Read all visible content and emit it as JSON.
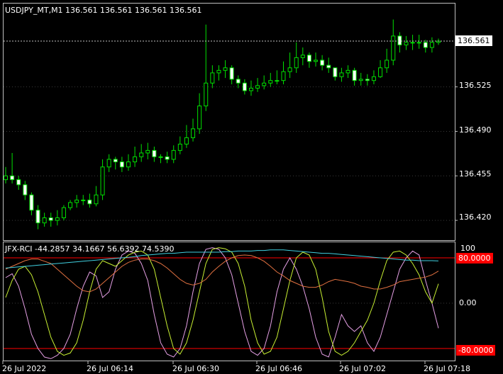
{
  "main_chart": {
    "header": "USDJPY_MT,M1  136.561 136.561 136.561 136.561",
    "price_ticks": [
      "136.525",
      "136.490",
      "136.455",
      "136.420"
    ],
    "current_price_tag": "136.561",
    "current_price": 136.561,
    "price_range": [
      136.405,
      136.59
    ],
    "colors": {
      "bull": "#00e000",
      "bear": "#ffffff",
      "bid_line": "#c0c0c0"
    }
  },
  "indicator": {
    "header": "JFX-RCI -44.2857 34.1667 56.6392 74.5390",
    "level_tags": [
      "80.0000",
      "-80.0000"
    ],
    "axis_labels": [
      "100",
      "0.00"
    ],
    "range": [
      -100,
      100
    ],
    "level_color": "#ff0000",
    "series_colors": [
      "#e6a0e6",
      "#c8f032",
      "#e07040",
      "#40d0e0"
    ]
  },
  "time_axis": [
    "26 Jul 2022",
    "26 Jul 06:14",
    "26 Jul 06:30",
    "26 Jul 06:46",
    "26 Jul 07:02",
    "26 Jul 07:18"
  ],
  "chart_data": {
    "type": "line",
    "candles": {
      "open": [
        136.452,
        136.455,
        136.452,
        136.448,
        136.44,
        136.428,
        136.418,
        136.422,
        136.42,
        136.422,
        136.43,
        136.434,
        136.436,
        136.436,
        136.433,
        136.44,
        136.462,
        136.468,
        136.466,
        136.462,
        136.466,
        136.47,
        136.473,
        136.475,
        136.47,
        136.47,
        136.468,
        136.475,
        136.48,
        136.485,
        136.492,
        136.51,
        136.528,
        136.536,
        136.538,
        136.54,
        136.531,
        136.528,
        136.522,
        136.524,
        136.526,
        136.528,
        136.53,
        136.53,
        136.537,
        136.54,
        136.548,
        136.55,
        136.545,
        136.546,
        136.542,
        136.54,
        136.533,
        136.536,
        136.538,
        136.53,
        136.531,
        136.53,
        136.533,
        136.54,
        136.546,
        136.565,
        136.558,
        136.56,
        136.56,
        136.56,
        136.556,
        136.56
      ],
      "close": [
        136.455,
        136.452,
        136.448,
        136.44,
        136.428,
        136.418,
        136.422,
        136.42,
        136.422,
        136.43,
        136.434,
        136.436,
        136.436,
        136.433,
        136.44,
        136.462,
        136.468,
        136.466,
        136.462,
        136.466,
        136.47,
        136.473,
        136.475,
        136.47,
        136.47,
        136.468,
        136.475,
        136.48,
        136.485,
        136.492,
        136.51,
        136.528,
        136.536,
        136.538,
        136.54,
        136.531,
        136.528,
        136.522,
        136.524,
        136.526,
        136.528,
        136.53,
        136.53,
        136.537,
        136.54,
        136.548,
        136.55,
        136.545,
        136.546,
        136.542,
        136.54,
        136.533,
        136.536,
        136.538,
        136.53,
        136.531,
        136.53,
        136.533,
        136.54,
        136.546,
        136.565,
        136.558,
        136.56,
        136.56,
        136.56,
        136.556,
        136.56,
        136.561
      ],
      "high": [
        136.462,
        136.473,
        136.455,
        136.451,
        136.442,
        136.432,
        136.426,
        136.426,
        136.428,
        136.432,
        136.436,
        136.44,
        136.44,
        136.441,
        136.447,
        136.468,
        136.472,
        136.47,
        136.47,
        136.472,
        136.478,
        136.48,
        136.481,
        136.478,
        136.472,
        136.474,
        136.479,
        136.486,
        136.495,
        136.5,
        136.52,
        136.574,
        136.542,
        136.542,
        136.546,
        136.542,
        136.534,
        136.531,
        136.53,
        136.532,
        136.534,
        136.536,
        136.538,
        136.545,
        136.552,
        136.56,
        136.556,
        136.552,
        136.552,
        136.55,
        136.548,
        136.54,
        136.54,
        136.542,
        136.54,
        136.536,
        136.535,
        136.538,
        136.546,
        136.555,
        136.578,
        136.568,
        136.565,
        136.566,
        136.566,
        136.562,
        136.564,
        136.563
      ],
      "low": [
        136.449,
        136.449,
        136.444,
        136.436,
        136.424,
        136.413,
        136.415,
        136.415,
        136.416,
        136.42,
        136.428,
        136.43,
        136.432,
        136.43,
        136.431,
        136.436,
        136.458,
        136.46,
        136.458,
        136.459,
        136.462,
        136.466,
        136.468,
        136.466,
        136.465,
        136.465,
        136.465,
        136.472,
        136.477,
        136.482,
        136.488,
        136.506,
        136.524,
        136.53,
        136.532,
        136.527,
        136.524,
        136.519,
        136.518,
        136.521,
        136.523,
        136.525,
        136.527,
        136.527,
        136.532,
        136.536,
        136.542,
        136.54,
        136.541,
        136.538,
        136.536,
        136.53,
        136.529,
        136.532,
        136.526,
        136.526,
        136.526,
        136.527,
        136.532,
        136.536,
        136.542,
        136.552,
        136.554,
        136.554,
        136.555,
        136.552,
        136.552,
        136.558
      ]
    },
    "rci_series": [
      {
        "values": [
          45,
          52,
          30,
          -10,
          -55,
          -80,
          -95,
          -98,
          -92,
          -80,
          -55,
          -10,
          30,
          55,
          48,
          10,
          20,
          60,
          85,
          92,
          88,
          70,
          40,
          -20,
          -70,
          -90,
          -95,
          -80,
          -40,
          20,
          70,
          95,
          98,
          95,
          80,
          50,
          0,
          -50,
          -85,
          -92,
          -80,
          -40,
          20,
          60,
          80,
          60,
          30,
          -10,
          -60,
          -90,
          -95,
          -60,
          -20,
          -40,
          -50,
          -40,
          -70,
          -85,
          -60,
          -20,
          20,
          60,
          80,
          92,
          85,
          40,
          0,
          -44.3
        ]
      },
      {
        "values": [
          10,
          40,
          60,
          65,
          50,
          20,
          -20,
          -60,
          -85,
          -92,
          -88,
          -70,
          -30,
          20,
          60,
          75,
          70,
          65,
          75,
          85,
          90,
          92,
          85,
          60,
          10,
          -40,
          -80,
          -90,
          -70,
          -30,
          20,
          70,
          95,
          98,
          96,
          90,
          70,
          30,
          -30,
          -70,
          -90,
          -85,
          -60,
          -10,
          40,
          80,
          90,
          85,
          60,
          10,
          -50,
          -85,
          -92,
          -85,
          -70,
          -50,
          -30,
          0,
          40,
          75,
          90,
          92,
          85,
          70,
          50,
          20,
          0,
          34.2
        ]
      },
      {
        "values": [
          60,
          65,
          70,
          75,
          78,
          78,
          74,
          70,
          60,
          50,
          40,
          30,
          22,
          20,
          25,
          35,
          45,
          55,
          65,
          72,
          76,
          78,
          78,
          75,
          70,
          62,
          52,
          42,
          35,
          32,
          35,
          42,
          55,
          65,
          74,
          80,
          84,
          85,
          84,
          80,
          74,
          65,
          55,
          48,
          40,
          35,
          30,
          28,
          28,
          32,
          38,
          42,
          40,
          38,
          35,
          30,
          28,
          25,
          25,
          28,
          32,
          38,
          40,
          42,
          44,
          46,
          50,
          56.6
        ]
      },
      {
        "values": [
          62,
          63,
          64,
          65,
          66,
          67,
          68,
          69,
          70,
          71,
          72,
          73,
          74,
          75,
          76,
          77,
          78,
          79,
          80,
          81,
          82,
          84,
          85,
          86,
          87,
          88,
          88,
          89,
          90,
          90,
          90,
          90,
          90,
          90,
          91,
          91,
          92,
          92,
          92,
          93,
          93,
          94,
          94,
          94,
          93,
          92,
          91,
          90,
          89,
          88,
          88,
          87,
          86,
          85,
          84,
          83,
          82,
          81,
          80,
          79,
          78,
          77,
          76,
          76,
          75,
          75,
          75,
          74.5
        ]
      }
    ]
  }
}
